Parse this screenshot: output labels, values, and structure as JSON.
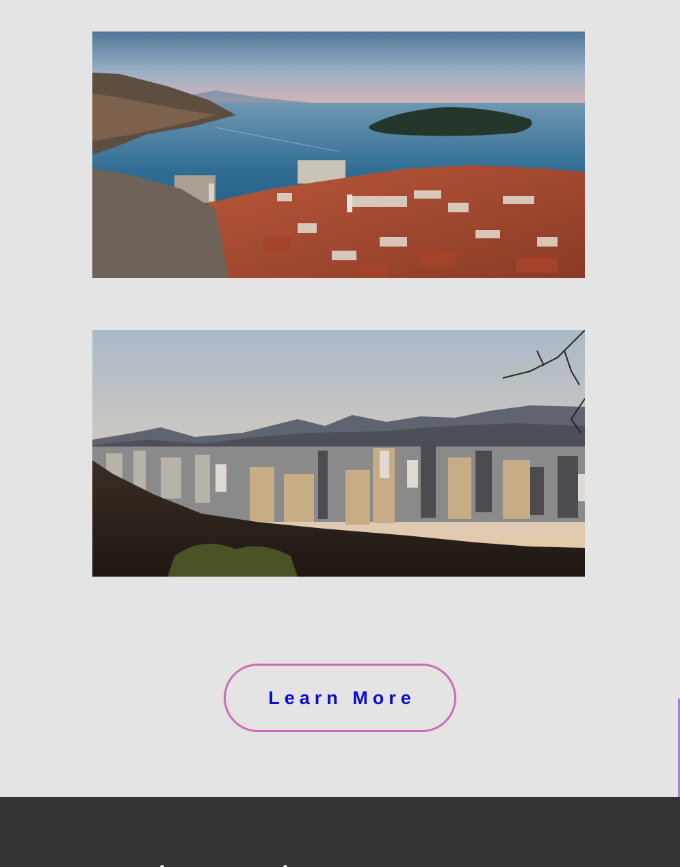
{
  "gallery": {
    "photos": [
      {
        "name": "coastal-old-town-photo"
      },
      {
        "name": "city-skyline-photo"
      }
    ]
  },
  "cta": {
    "label": "Learn More",
    "border_color": "#cc6bb2",
    "text_color": "#0a0ad0"
  },
  "footer": {
    "background": "#333333"
  },
  "page": {
    "background": "#e4e4e4"
  }
}
